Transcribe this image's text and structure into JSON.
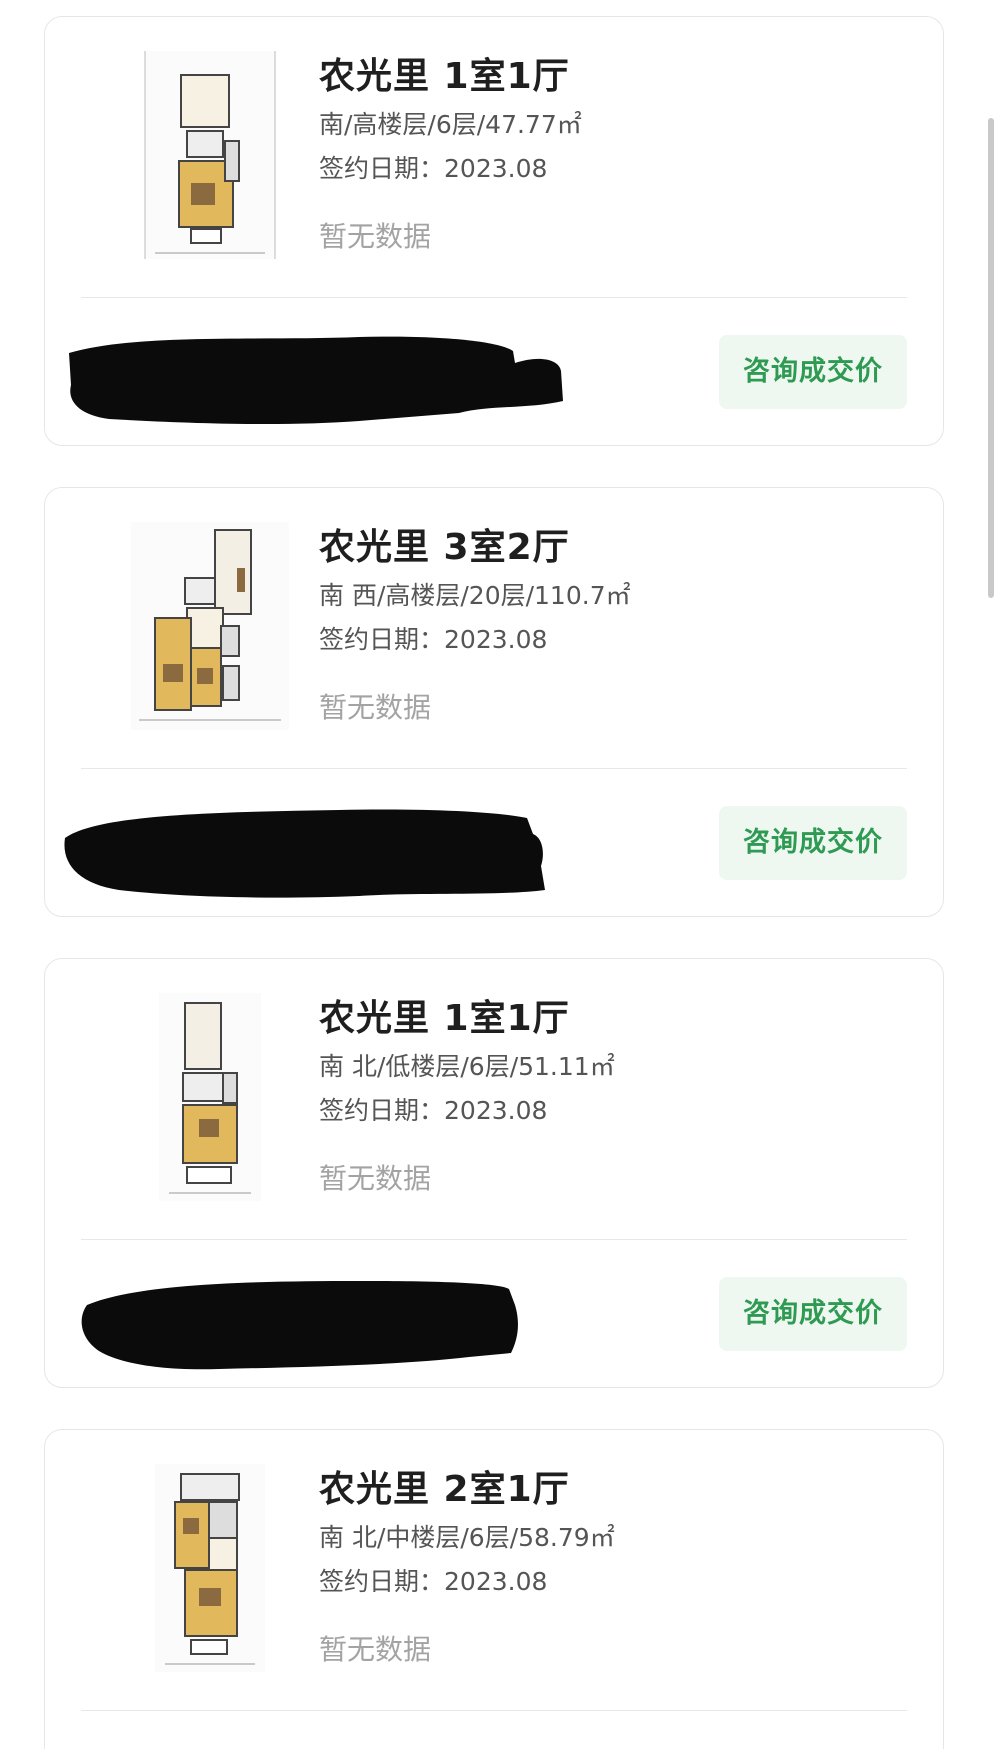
{
  "listings": [
    {
      "title": "农光里 1室1厅",
      "meta": "南/高楼层/6层/47.77㎡",
      "date_label": "签约日期：",
      "date_value": "2023.08",
      "price_status": "暂无数据",
      "action_label": "咨询成交价"
    },
    {
      "title": "农光里 3室2厅",
      "meta": "南 西/高楼层/20层/110.7㎡",
      "date_label": "签约日期：",
      "date_value": "2023.08",
      "price_status": "暂无数据",
      "action_label": "咨询成交价"
    },
    {
      "title": "农光里 1室1厅",
      "meta": "南 北/低楼层/6层/51.11㎡",
      "date_label": "签约日期：",
      "date_value": "2023.08",
      "price_status": "暂无数据",
      "action_label": "咨询成交价"
    },
    {
      "title": "农光里 2室1厅",
      "meta": "南 北/中楼层/6层/58.79㎡",
      "date_label": "签约日期：",
      "date_value": "2023.08",
      "price_status": "暂无数据"
    }
  ],
  "colors": {
    "action_text": "#2e9a52",
    "action_bg": "#eef8f1",
    "muted_text": "#a3a3a3",
    "floorplan_room": "#e2b85c"
  },
  "icons": {
    "floorplan": "floorplan-thumbnail",
    "redaction": "redacted-agent-info"
  }
}
